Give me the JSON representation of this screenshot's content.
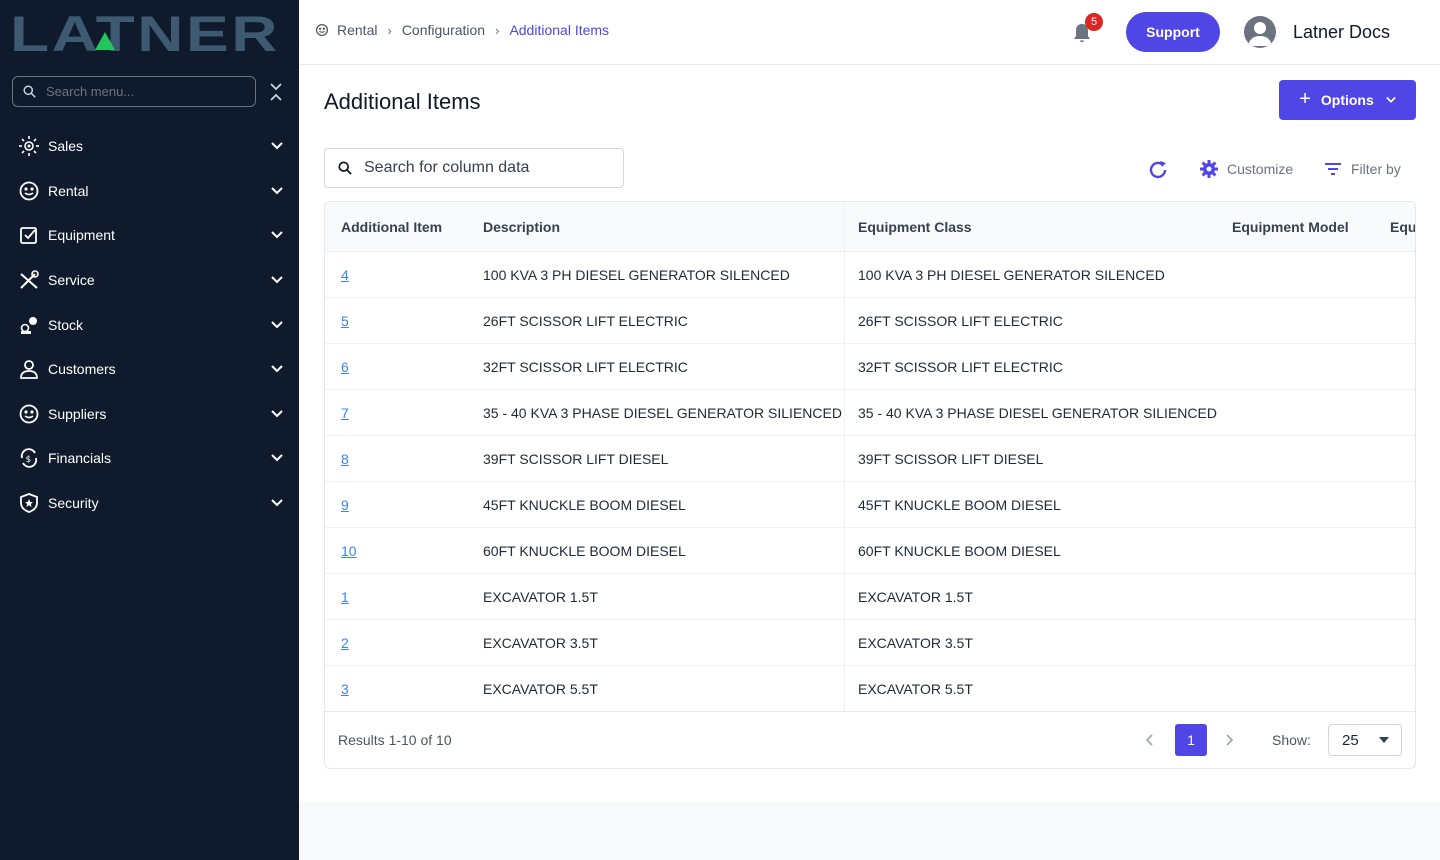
{
  "app": {
    "logo_text": "LATNER"
  },
  "sidebar": {
    "search_placeholder": "Search menu...",
    "items": [
      {
        "label": "Sales",
        "icon": "sales-icon"
      },
      {
        "label": "Rental",
        "icon": "rental-icon"
      },
      {
        "label": "Equipment",
        "icon": "equipment-icon"
      },
      {
        "label": "Service",
        "icon": "service-icon"
      },
      {
        "label": "Stock",
        "icon": "stock-icon"
      },
      {
        "label": "Customers",
        "icon": "customers-icon"
      },
      {
        "label": "Suppliers",
        "icon": "suppliers-icon"
      },
      {
        "label": "Financials",
        "icon": "financials-icon"
      },
      {
        "label": "Security",
        "icon": "security-icon"
      }
    ]
  },
  "header": {
    "breadcrumb": [
      "Rental",
      "Configuration",
      "Additional Items"
    ],
    "notification_count": "5",
    "support_label": "Support",
    "user_name": "Latner Docs"
  },
  "page": {
    "title": "Additional Items",
    "options_label": "Options",
    "search_placeholder": "Search for column data",
    "customize_label": "Customize",
    "filter_label": "Filter by"
  },
  "table": {
    "columns": [
      "Additional Item",
      "Description",
      "Equipment Class",
      "Equipment Model",
      "Equ"
    ],
    "rows": [
      [
        "4",
        "100 KVA 3 PH DIESEL GENERATOR SILENCED",
        "100 KVA 3 PH DIESEL GENERATOR SILENCED"
      ],
      [
        "5",
        "26FT SCISSOR LIFT ELECTRIC",
        "26FT SCISSOR LIFT ELECTRIC"
      ],
      [
        "6",
        "32FT SCISSOR LIFT ELECTRIC",
        "32FT SCISSOR LIFT ELECTRIC"
      ],
      [
        "7",
        "35 - 40 KVA 3 PHASE DIESEL GENERATOR SILIENCED",
        "35 - 40 KVA 3 PHASE DIESEL GENERATOR SILIENCED"
      ],
      [
        "8",
        "39FT SCISSOR LIFT DIESEL",
        "39FT SCISSOR LIFT DIESEL"
      ],
      [
        "9",
        "45FT KNUCKLE BOOM DIESEL",
        "45FT KNUCKLE BOOM DIESEL"
      ],
      [
        "10",
        "60FT KNUCKLE BOOM DIESEL",
        "60FT KNUCKLE BOOM DIESEL"
      ],
      [
        "1",
        "EXCAVATOR 1.5T",
        "EXCAVATOR 1.5T"
      ],
      [
        "2",
        "EXCAVATOR 3.5T",
        "EXCAVATOR 3.5T"
      ],
      [
        "3",
        "EXCAVATOR 5.5T",
        "EXCAVATOR 5.5T"
      ]
    ]
  },
  "pagination": {
    "results_text": "Results 1-10 of 10",
    "current_page": "1",
    "show_label": "Show:",
    "page_size": "25"
  },
  "colors": {
    "sidebar_bg": "#0f1b2d",
    "accent": "#4f46e5",
    "link": "#3b82f6",
    "badge": "#dc2626",
    "logo": "#3d5a70",
    "logo_accent": "#22c55e"
  }
}
